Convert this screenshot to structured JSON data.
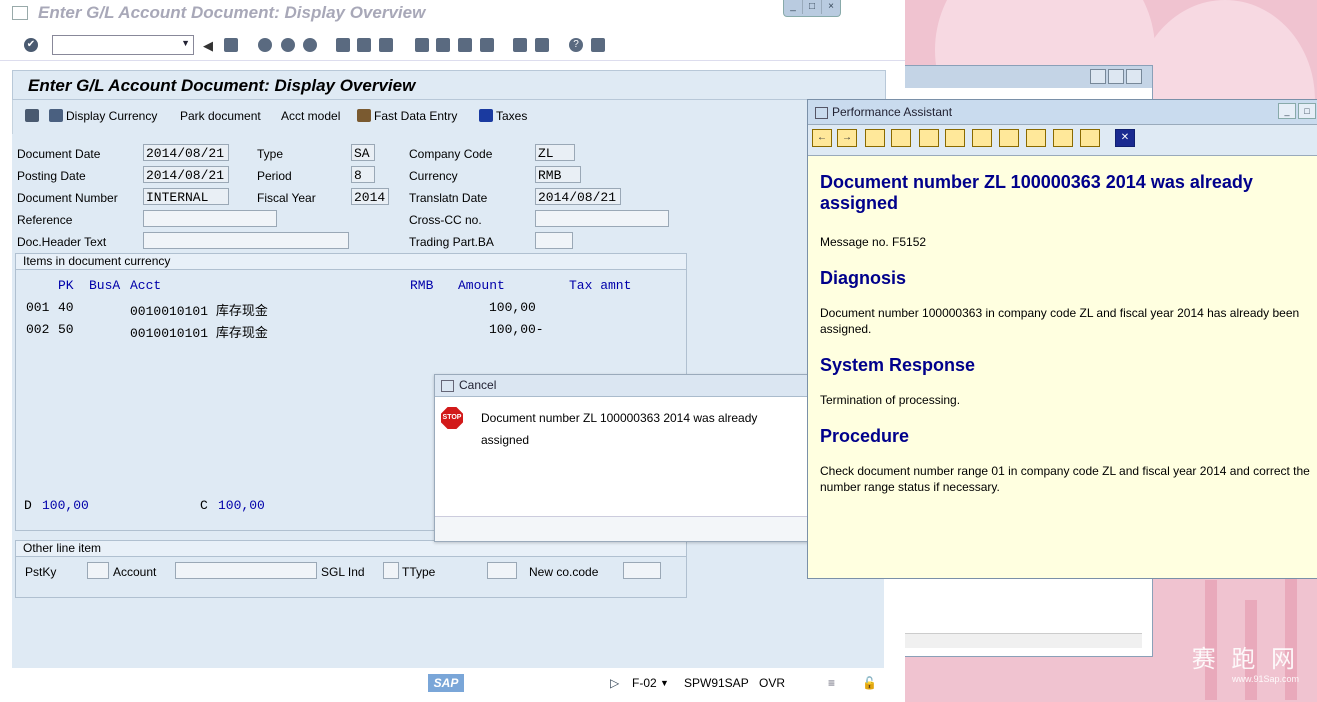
{
  "window": {
    "title": "Enter G/L Account Document: Display Overview",
    "screen_title": "Enter G/L Account Document: Display Overview"
  },
  "appbar": {
    "display_currency": "Display Currency",
    "park_document": "Park document",
    "acct_model": "Acct model",
    "fast_data_entry": "Fast Data Entry",
    "taxes": "Taxes"
  },
  "header": {
    "document_date_label": "Document Date",
    "document_date": "2014/08/21",
    "type_label": "Type",
    "type": "SA",
    "company_code_label": "Company Code",
    "company_code": "ZL",
    "posting_date_label": "Posting Date",
    "posting_date": "2014/08/21",
    "period_label": "Period",
    "period": "8",
    "currency_label": "Currency",
    "currency": "RMB",
    "document_number_label": "Document Number",
    "document_number": "INTERNAL",
    "fiscal_year_label": "Fiscal Year",
    "fiscal_year": "2014",
    "translatn_date_label": "Translatn Date",
    "translatn_date": "2014/08/21",
    "reference_label": "Reference",
    "cross_cc_label": "Cross-CC no.",
    "doc_header_text_label": "Doc.Header Text",
    "trading_part_label": "Trading Part.BA"
  },
  "items": {
    "group_title": "Items in document currency",
    "columns": {
      "pk": "PK",
      "busa": "BusA",
      "acct": "Acct",
      "rmb": "RMB",
      "amount": "Amount",
      "tax": "Tax amnt"
    },
    "rows": [
      {
        "no": "001",
        "pk": "40",
        "acct": "0010010101 库存现金",
        "amount": "100,00"
      },
      {
        "no": "002",
        "pk": "50",
        "acct": "0010010101 库存现金",
        "amount": "100,00-"
      }
    ],
    "debit_label": "D",
    "debit_total": "100,00",
    "credit_label": "C",
    "credit_total": "100,00"
  },
  "other_line": {
    "group_title": "Other line item",
    "pstky_label": "PstKy",
    "account_label": "Account",
    "sgl_label": "SGL Ind",
    "ttype_label": "TType",
    "newco_label": "New co.code"
  },
  "status": {
    "tcode": "F-02",
    "system": "SPW91SAP",
    "mode": "OVR",
    "sap_logo": "SAP"
  },
  "cancel_popup": {
    "title": "Cancel",
    "stop_icon_text": "STOP",
    "message": "Document number ZL 100000363 2014 was already assigned"
  },
  "performance_assistant": {
    "title": "Performance Assistant",
    "heading": "Document number ZL 100000363 2014 was already assigned",
    "message_no": "Message no. F5152",
    "diagnosis_title": "Diagnosis",
    "diagnosis_text": "Document number 100000363 in company code ZL and fiscal year 2014 has already been assigned.",
    "response_title": "System Response",
    "response_text": "Termination of processing.",
    "procedure_title": "Procedure",
    "procedure_text": "Check document number range 01 in company code ZL and fiscal year 2014 and correct the number range status if necessary."
  },
  "watermark": {
    "title": "赛 跑 网",
    "url": "www.91Sap.com"
  }
}
